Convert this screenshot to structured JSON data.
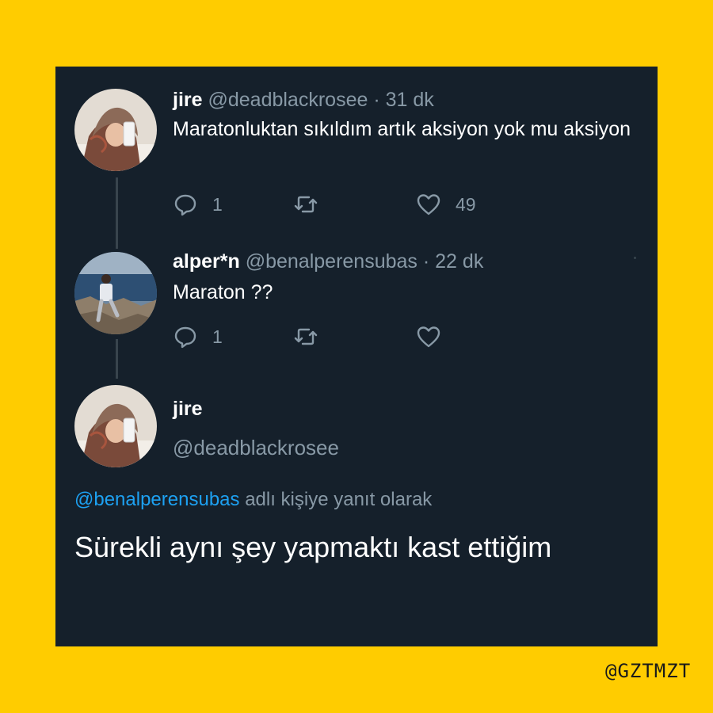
{
  "thread": [
    {
      "name": "jire",
      "handle": "@deadblackrosee",
      "time": "31 dk",
      "separator": "·",
      "text": "Maratonluktan sıkıldım artık aksiyon yok mu aksiyon",
      "replies": "1",
      "retweets": "",
      "likes": "49",
      "avatar_icon": "selfie-avatar"
    },
    {
      "name": "alper*n",
      "handle": "@benalperensubas",
      "time": "22 dk",
      "separator": "·",
      "text": "Maraton ??",
      "replies": "1",
      "retweets": "",
      "likes": "",
      "avatar_icon": "outdoor-photo-avatar"
    }
  ],
  "main_tweet": {
    "name": "jire",
    "handle": "@deadblackrosee",
    "reply_to_mention": "@benalperensubas",
    "reply_to_suffix": "adlı kişiye yanıt olarak",
    "text": "Sürekli aynı şey yapmaktı kast ettiğim",
    "avatar_icon": "selfie-avatar"
  },
  "watermark": "@GZTMZT",
  "colors": {
    "background": "#FFCC00",
    "card": "#15202B",
    "muted_text": "#8899A6",
    "link": "#1DA1F2",
    "text": "#FFFFFF"
  },
  "icons": [
    "reply-icon",
    "retweet-icon",
    "like-icon"
  ]
}
